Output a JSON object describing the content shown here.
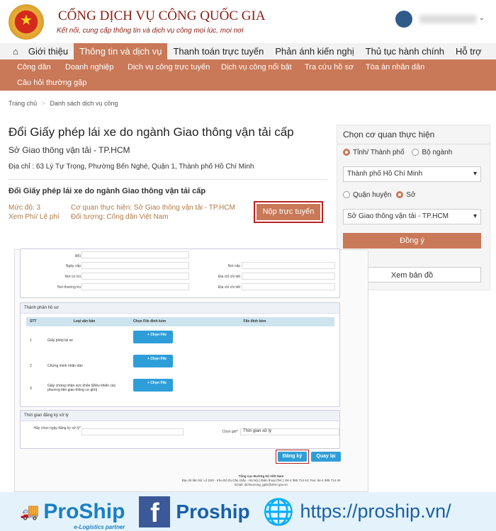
{
  "header": {
    "brand": "CỔNG DỊCH VỤ CÔNG QUỐC GIA",
    "tagline": "Kết nối, cung cấp thông tin và dịch vụ công mọi lúc, mọi nơi",
    "logo_text": "★"
  },
  "nav": {
    "items": [
      "Giới thiệu",
      "Thông tin và dịch vụ",
      "Thanh toán trực tuyến",
      "Phản ánh kiến nghị",
      "Thủ tục hành chính",
      "Hỗ trợ"
    ],
    "active": "Thông tin và dịch vụ"
  },
  "subnav": {
    "items": [
      "Công dân",
      "Doanh nghiệp",
      "Dịch vụ công trực tuyến",
      "Dịch vụ công nổi bật",
      "Tra cứu hồ sơ",
      "Tòa án nhân dân",
      "Câu hỏi thường gặp"
    ]
  },
  "breadcrumb": [
    "Trang chủ",
    "Danh sách dịch vụ công"
  ],
  "main": {
    "title": "Đổi Giấy phép lái xe do ngành Giao thông vận tải cấp",
    "agency": "Sở Giao thông vận tải - TP.HCM",
    "address": "Địa chỉ : 63 Lý Tự Trọng, Phường Bến Nghé, Quận 1, Thành phố Hồ Chí Minh",
    "service_title": "Đổi Giấy phép lái xe do ngành Giao thông vận tải cấp",
    "level": "Mức độ: 3",
    "fee": "Xem Phí/ Lệ phí",
    "org": "Cơ quan thực hiện: Sở Giao thông vận tải - TP.HCM",
    "target": "Đối tượng: Công dân Việt Nam",
    "submit": "Nộp trực tuyến"
  },
  "panel": {
    "title": "Chọn cơ quan thực hiện",
    "radio1": "Tỉnh/ Thành phố",
    "radio2": "Bộ ngành",
    "select1": "Thành phố Hồ Chí Minh",
    "radio3": "Quận huyện",
    "radio4": "Sở",
    "select2": "Sở Giao thông vận tải - TP.HCM",
    "confirm": "Đồng ý",
    "map": "Xem bản đồ"
  },
  "form": {
    "partial_label": "đổi)",
    "fields": [
      "Ngày cấp",
      "Nơi cấp",
      "Nơi cư trú",
      "Địa chỉ chi tiết",
      "Nơi thường trú",
      "Địa chỉ chi tiết"
    ],
    "docs_title": "Thành phần hồ sơ",
    "columns": [
      "STT",
      "Loại văn bản",
      "Chọn File đính kèm",
      "File đính kèm"
    ],
    "rows": [
      {
        "stt": "1",
        "name": "Giấy phép lái xe"
      },
      {
        "stt": "2",
        "name": "Chứng minh nhân dân"
      },
      {
        "stt": "3",
        "name": "Giấy chứng nhận sức khỏe (Điều khiển các phương tiện giao thông cơ giới)"
      }
    ],
    "choose_file": "Chọn File",
    "time_title": "Thời gian đăng ký xử lý",
    "date_label": "Hãy chọn ngày đăng ký xử lý*",
    "hour_label": "Chọn giờ*",
    "hour_value": "Thời gian xử lý",
    "register": "Đăng ký",
    "back": "Quay lại",
    "footer_org": "Tổng cục Đường bộ Việt Nam",
    "footer_addr": "Địa chỉ liên hệ: Lô D20 - Khu Đô thị Cầu Giấy - Hà Nội | Điện thoại (Tel.): 84-4 385 714 44; Fax: 84-4 385 714 40",
    "footer_email": "Email: dichvucong_gplx@drvn.gov.vn"
  },
  "banner": {
    "brand": "ProShip",
    "sub": "e-Logistics partner",
    "fb": "Proship",
    "url": "https://proship.vn/"
  },
  "colors": {
    "accent": "#c97858",
    "button_blue": "#2e9ed8",
    "highlight": "#b22222"
  }
}
